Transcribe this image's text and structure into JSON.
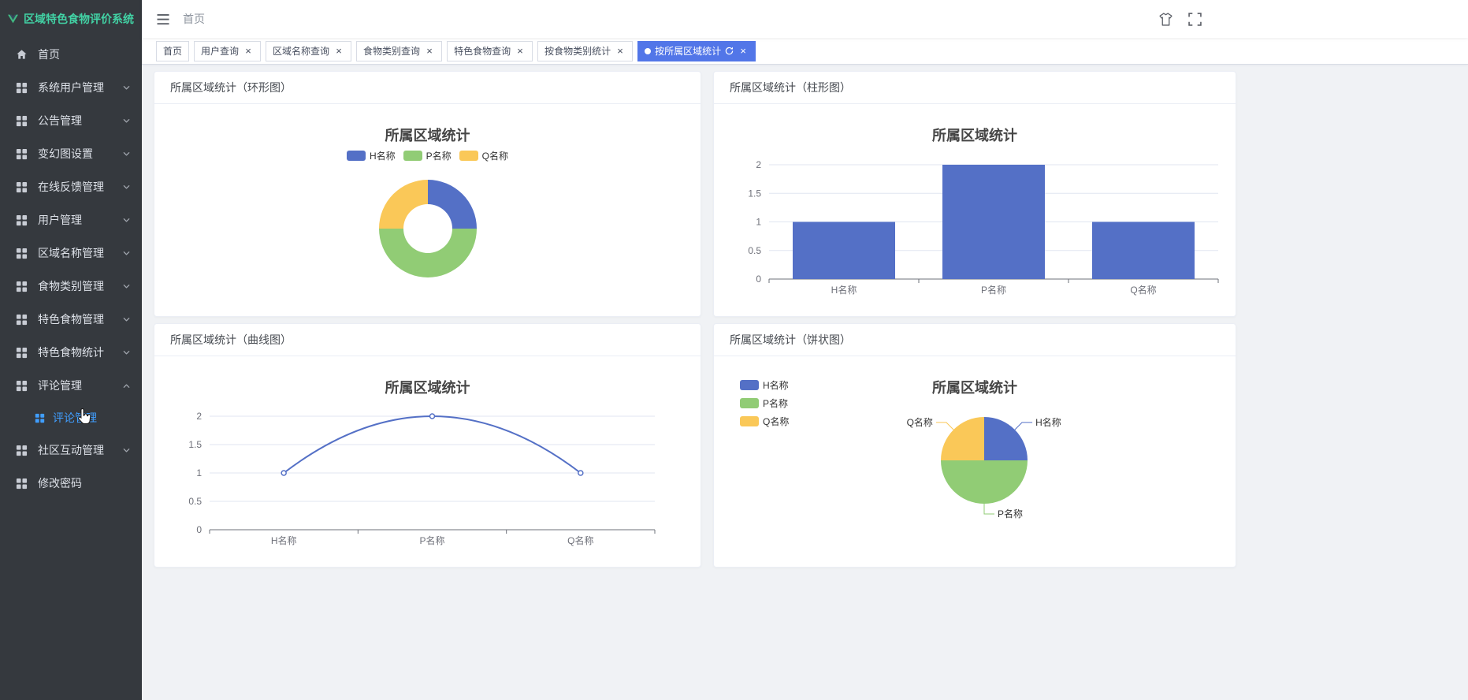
{
  "app": {
    "title": "区域特色食物评价系统"
  },
  "header": {
    "breadcrumb": "首页"
  },
  "colors": {
    "sidebar_bg": "#35393e",
    "logo_green": "#41b883",
    "logo_text": "#42d3a5",
    "menu_active_text": "#409eff",
    "active_tab_bg": "#5276e8",
    "content_bg": "#f0f2f5",
    "chart_blue": "#5470c6",
    "chart_green": "#91cc75",
    "chart_yellow": "#fac858"
  },
  "sidebar": {
    "items": [
      {
        "label": "首页"
      },
      {
        "label": "系统用户管理"
      },
      {
        "label": "公告管理"
      },
      {
        "label": "变幻图设置"
      },
      {
        "label": "在线反馈管理"
      },
      {
        "label": "用户管理"
      },
      {
        "label": "区域名称管理"
      },
      {
        "label": "食物类别管理"
      },
      {
        "label": "特色食物管理"
      },
      {
        "label": "特色食物统计"
      },
      {
        "label": "评论管理"
      },
      {
        "label": "社区互动管理"
      },
      {
        "label": "修改密码"
      }
    ],
    "submenu_items": [
      {
        "label": "评论管理"
      }
    ]
  },
  "tabs": [
    {
      "label": "首页",
      "closable": false,
      "active": false
    },
    {
      "label": "用户查询",
      "closable": true,
      "active": false
    },
    {
      "label": "区域名称查询",
      "closable": true,
      "active": false
    },
    {
      "label": "食物类别查询",
      "closable": true,
      "active": false
    },
    {
      "label": "特色食物查询",
      "closable": true,
      "active": false
    },
    {
      "label": "按食物类别统计",
      "closable": true,
      "active": false
    },
    {
      "label": "按所属区域统计",
      "closable": true,
      "active": true,
      "refreshable": true
    }
  ],
  "panels": [
    {
      "title": "所属区域统计（环形图）"
    },
    {
      "title": "所属区域统计（柱形图）"
    },
    {
      "title": "所属区域统计（曲线图）"
    },
    {
      "title": "所属区域统计（饼状图）"
    }
  ],
  "chart_data": [
    {
      "type": "donut",
      "title": "所属区域统计",
      "categories": [
        "H名称",
        "P名称",
        "Q名称"
      ],
      "values": [
        1,
        2,
        1
      ],
      "colors": [
        "#5470c6",
        "#91cc75",
        "#fac858"
      ],
      "legend_position": "top"
    },
    {
      "type": "bar",
      "title": "所属区域统计",
      "categories": [
        "H名称",
        "P名称",
        "Q名称"
      ],
      "values": [
        1,
        2,
        1
      ],
      "color": "#5470c6",
      "ylim": [
        0,
        2
      ],
      "yticks": [
        0,
        0.5,
        1,
        1.5,
        2
      ],
      "grid": true
    },
    {
      "type": "line",
      "title": "所属区域统计",
      "categories": [
        "H名称",
        "P名称",
        "Q名称"
      ],
      "values": [
        1,
        2,
        1
      ],
      "color": "#5470c6",
      "smooth": true,
      "ylim": [
        0,
        2
      ],
      "yticks": [
        0,
        0.5,
        1,
        1.5,
        2
      ],
      "grid": true
    },
    {
      "type": "pie",
      "title": "所属区域统计",
      "categories": [
        "H名称",
        "P名称",
        "Q名称"
      ],
      "values": [
        1,
        2,
        1
      ],
      "colors": [
        "#5470c6",
        "#91cc75",
        "#fac858"
      ],
      "legend_position": "left"
    }
  ]
}
